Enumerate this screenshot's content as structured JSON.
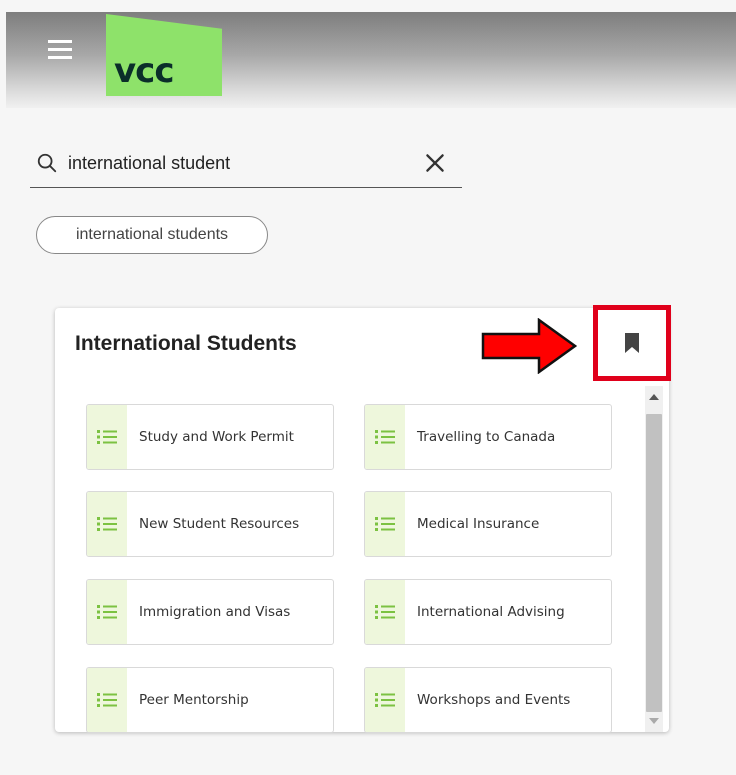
{
  "header": {
    "logo_text": "vcc"
  },
  "search": {
    "value": "international student",
    "placeholder": ""
  },
  "suggestion_chip": "international students",
  "card": {
    "title": "International Students",
    "tiles": [
      {
        "label": "Study and Work Permit"
      },
      {
        "label": "Travelling to Canada"
      },
      {
        "label": "New Student Resources"
      },
      {
        "label": "Medical Insurance"
      },
      {
        "label": "Immigration and Visas"
      },
      {
        "label": "International Advising"
      },
      {
        "label": "Peer Mentorship"
      },
      {
        "label": "Workshops and Events"
      }
    ]
  },
  "icons": {
    "menu": "hamburger-menu-icon",
    "search": "search-icon",
    "clear": "close-icon",
    "bookmark": "bookmark-icon",
    "tile": "list-icon",
    "annotation": "red-arrow-icon"
  },
  "colors": {
    "logo_bg": "#8ee26a",
    "logo_text": "#0b2e2a",
    "tile_icon": "#7cc242",
    "tile_icon_bg": "#eef7dc",
    "highlight": "#e0001b",
    "arrow_fill": "#ff0000"
  }
}
